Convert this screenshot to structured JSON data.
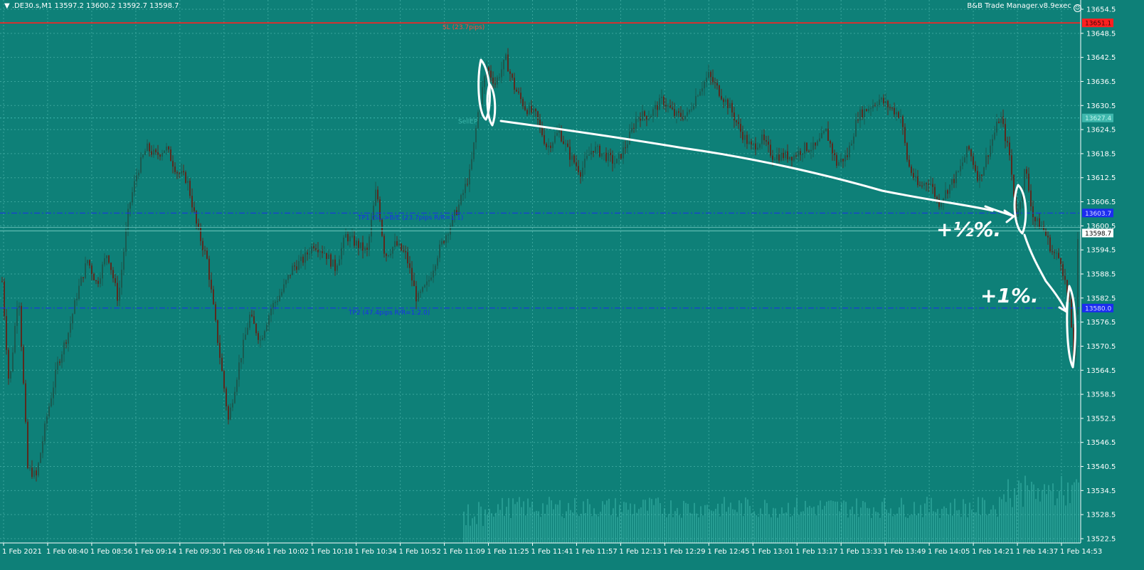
{
  "header": {
    "symbol_line": "▼  .DE30.s,M1  13597.2 13600.2 13592.7 13598.7",
    "ea_label": "B&B Trade Manager.v8.9exec",
    "ea_icon": "smiley-icon"
  },
  "colors": {
    "background": "#0e8078",
    "grid": "#3aa59c",
    "bull_candle": "#1b5a50",
    "bear_candle": "#5a2a1e",
    "sl_line": "#ff2020",
    "tp_line": "#1c2cf0",
    "volume": "#3fb8ad",
    "annotation": "#ffffff"
  },
  "chart_data": {
    "type": "candlestick",
    "symbol": ".DE30.s",
    "timeframe": "M1",
    "ohlc_last": {
      "open": 13597.2,
      "high": 13600.2,
      "low": 13592.7,
      "close": 13598.7
    },
    "ylim": [
      13519.5,
      13656.5
    ],
    "y_ticks": [
      13654.5,
      13648.5,
      13642.5,
      13636.5,
      13630.5,
      13624.5,
      13618.5,
      13612.5,
      13606.5,
      13600.5,
      13594.5,
      13588.5,
      13582.5,
      13576.5,
      13570.5,
      13564.5,
      13558.5,
      13552.5,
      13546.5,
      13540.5,
      13534.5,
      13528.5,
      13522.5
    ],
    "x_labels": [
      "1 Feb 2021",
      "1 Feb 08:40",
      "1 Feb 08:56",
      "1 Feb 09:14",
      "1 Feb 09:30",
      "1 Feb 09:46",
      "1 Feb 10:02",
      "1 Feb 10:18",
      "1 Feb 10:34",
      "1 Feb 10:52",
      "1 Feb 11:09",
      "1 Feb 11:25",
      "1 Feb 11:41",
      "1 Feb 11:57",
      "1 Feb 12:13",
      "1 Feb 12:29",
      "1 Feb 12:45",
      "1 Feb 13:01",
      "1 Feb 13:17",
      "1 Feb 13:33",
      "1 Feb 13:49",
      "1 Feb 14:05",
      "1 Feb 14:21",
      "1 Feb 14:37",
      "1 Feb 14:53"
    ],
    "price_path": [
      [
        0,
        13592
      ],
      [
        12,
        13560
      ],
      [
        25,
        13585
      ],
      [
        38,
        13540
      ],
      [
        50,
        13538
      ],
      [
        65,
        13553
      ],
      [
        80,
        13566
      ],
      [
        95,
        13574
      ],
      [
        108,
        13584
      ],
      [
        122,
        13592
      ],
      [
        135,
        13586
      ],
      [
        150,
        13594
      ],
      [
        165,
        13582
      ],
      [
        180,
        13605
      ],
      [
        192,
        13614
      ],
      [
        205,
        13620
      ],
      [
        218,
        13618
      ],
      [
        232,
        13620
      ],
      [
        248,
        13614
      ],
      [
        262,
        13612
      ],
      [
        276,
        13600
      ],
      [
        290,
        13592
      ],
      [
        305,
        13572
      ],
      [
        320,
        13552
      ],
      [
        335,
        13566
      ],
      [
        350,
        13578
      ],
      [
        365,
        13572
      ],
      [
        380,
        13580
      ],
      [
        395,
        13584
      ],
      [
        410,
        13590
      ],
      [
        425,
        13592
      ],
      [
        440,
        13596
      ],
      [
        455,
        13594
      ],
      [
        470,
        13590
      ],
      [
        485,
        13598
      ],
      [
        500,
        13596
      ],
      [
        515,
        13594
      ],
      [
        528,
        13610
      ],
      [
        540,
        13593
      ],
      [
        555,
        13596
      ],
      [
        570,
        13593
      ],
      [
        585,
        13582
      ],
      [
        600,
        13586
      ],
      [
        615,
        13594
      ],
      [
        630,
        13600
      ],
      [
        645,
        13606
      ],
      [
        660,
        13614
      ],
      [
        672,
        13630
      ],
      [
        683,
        13640
      ],
      [
        695,
        13636
      ],
      [
        710,
        13642
      ],
      [
        722,
        13635
      ],
      [
        737,
        13630
      ],
      [
        752,
        13628
      ],
      [
        768,
        13620
      ],
      [
        785,
        13624
      ],
      [
        800,
        13618
      ],
      [
        815,
        13614
      ],
      [
        832,
        13620
      ],
      [
        850,
        13618
      ],
      [
        865,
        13616
      ],
      [
        880,
        13621
      ],
      [
        895,
        13628
      ],
      [
        912,
        13628
      ],
      [
        930,
        13632
      ],
      [
        948,
        13628
      ],
      [
        965,
        13628
      ],
      [
        980,
        13634
      ],
      [
        995,
        13638
      ],
      [
        1010,
        13634
      ],
      [
        1025,
        13630
      ],
      [
        1040,
        13624
      ],
      [
        1055,
        13620
      ],
      [
        1070,
        13622
      ],
      [
        1085,
        13618
      ],
      [
        1100,
        13618
      ],
      [
        1115,
        13618
      ],
      [
        1130,
        13620
      ],
      [
        1145,
        13620
      ],
      [
        1160,
        13624
      ],
      [
        1175,
        13616
      ],
      [
        1190,
        13618
      ],
      [
        1205,
        13628
      ],
      [
        1220,
        13630
      ],
      [
        1235,
        13632
      ],
      [
        1250,
        13630
      ],
      [
        1265,
        13628
      ],
      [
        1275,
        13616
      ],
      [
        1290,
        13610
      ],
      [
        1305,
        13612
      ],
      [
        1318,
        13606
      ],
      [
        1332,
        13610
      ],
      [
        1347,
        13614
      ],
      [
        1360,
        13620
      ],
      [
        1375,
        13612
      ],
      [
        1390,
        13620
      ],
      [
        1405,
        13628
      ],
      [
        1418,
        13618
      ],
      [
        1428,
        13602
      ],
      [
        1440,
        13615
      ],
      [
        1452,
        13602
      ],
      [
        1465,
        13600
      ],
      [
        1478,
        13594
      ],
      [
        1490,
        13592
      ],
      [
        1503,
        13580
      ],
      [
        1509,
        13566
      ],
      [
        1514,
        13594
      ],
      [
        1520,
        13599
      ]
    ],
    "levels": [
      {
        "label": "SL (23.7pips)",
        "price": 13651.1,
        "tag": "13651.1",
        "style": "solid",
        "color": "#ff2020"
      },
      {
        "label": "SellEP",
        "price": 13627.4,
        "tag": "13627.4",
        "style": "dash",
        "color": "#3fb8ad"
      },
      {
        "label": "TP1 (SL->B/E (23.7pips R/R=1:1)",
        "price": 13603.7,
        "tag": "13603.7",
        "style": "dashdot",
        "color": "#1c2cf0"
      },
      {
        "label": "TP2 (47.4pips R/R=1:2.0)",
        "price": 13580.0,
        "tag": "13580.0",
        "style": "dashdot",
        "color": "#1c2cf0"
      }
    ],
    "current_price": {
      "price": 13598.7,
      "tag": "13598.7"
    },
    "annotations": [
      {
        "text": "+½%.",
        "at_price": 13600.5
      },
      {
        "text": "+1%.",
        "at_price": 13581.5
      }
    ],
    "grid": true,
    "volume_shown": true
  }
}
